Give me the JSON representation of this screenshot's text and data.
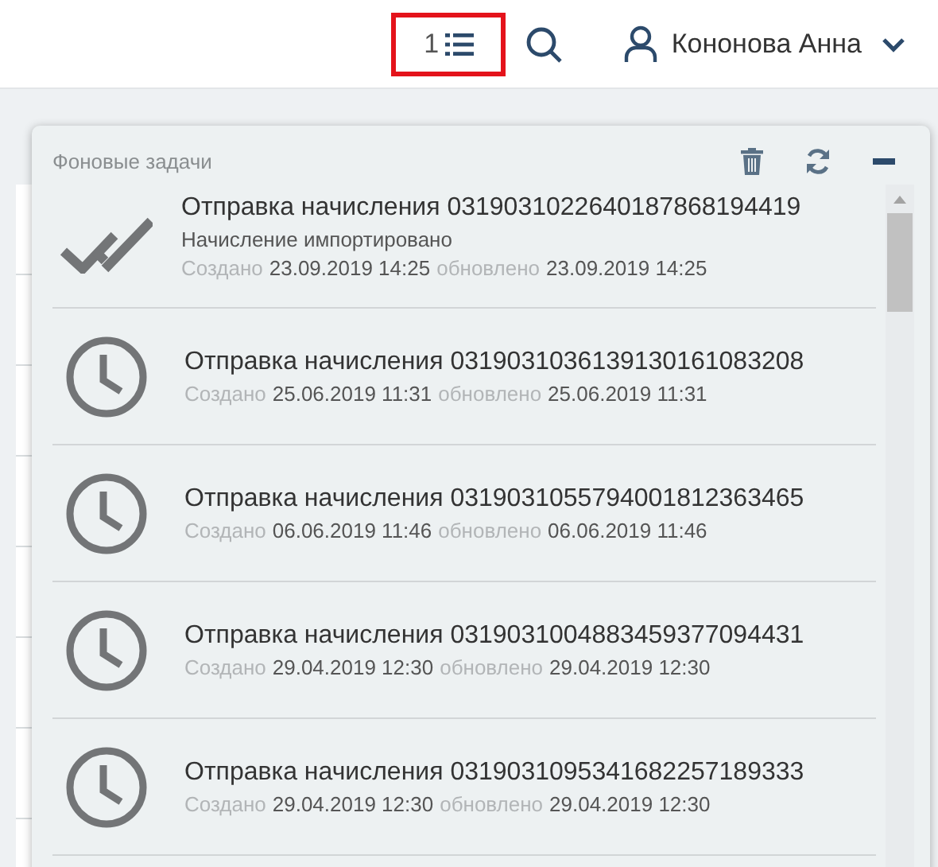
{
  "topbar": {
    "task_count": "1",
    "task_button_highlighted": true,
    "user_name": "Кононова Анна"
  },
  "panel": {
    "title": "Фоновые задачи",
    "tasks": [
      {
        "kind": "done",
        "title": "Отправка начисления 0319031022640187868194419",
        "status": "Начисление импортировано",
        "created_label": "Создано",
        "created": "23.09.2019 14:25",
        "updated_label": "обновлено",
        "updated": "23.09.2019 14:25"
      },
      {
        "kind": "pending",
        "title": "Отправка начисления 0319031036139130161083208",
        "created_label": "Создано",
        "created": "25.06.2019 11:31",
        "updated_label": "обновлено",
        "updated": "25.06.2019 11:31"
      },
      {
        "kind": "pending",
        "title": "Отправка начисления 0319031055794001812363465",
        "created_label": "Создано",
        "created": "06.06.2019 11:46",
        "updated_label": "обновлено",
        "updated": "06.06.2019 11:46"
      },
      {
        "kind": "pending",
        "title": "Отправка начисления 0319031004883459377094431",
        "created_label": "Создано",
        "created": "29.04.2019 12:30",
        "updated_label": "обновлено",
        "updated": "29.04.2019 12:30"
      },
      {
        "kind": "pending",
        "title": "Отправка начисления 0319031095341682257189333",
        "created_label": "Создано",
        "created": "29.04.2019 12:30",
        "updated_label": "обновлено",
        "updated": "29.04.2019 12:30"
      }
    ]
  }
}
